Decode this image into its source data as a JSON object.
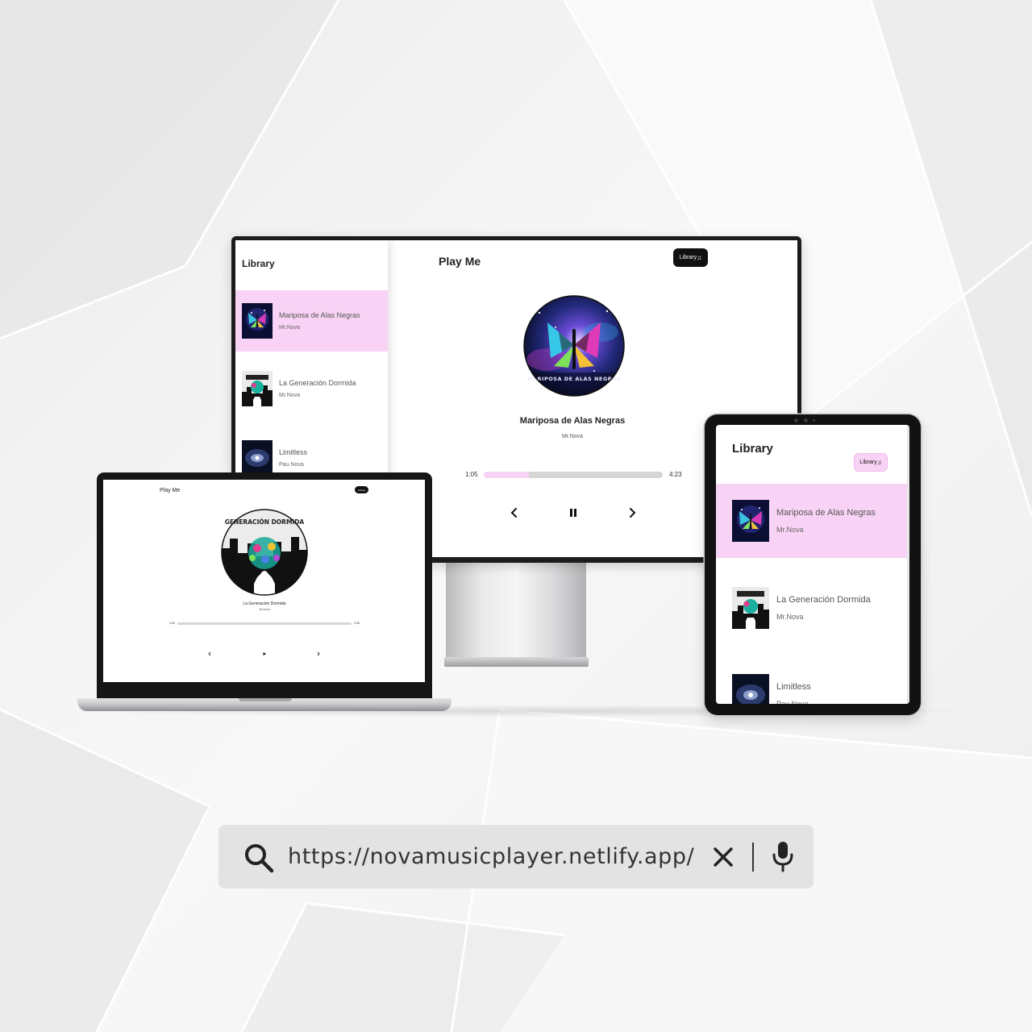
{
  "colors": {
    "accent_pink": "#f9d3f5",
    "screen_bezel": "#1c1c1c",
    "search_bg": "#e3e3e3",
    "text_dark": "#222222"
  },
  "library": {
    "title": "Library",
    "button_label": "Library"
  },
  "app": {
    "title": "Play Me"
  },
  "songs": [
    {
      "name": "Mariposa de Alas Negras",
      "artist": "Mr.Nova",
      "cover": "butterfly-cover"
    },
    {
      "name": "La Generación Dormida",
      "artist": "Mr.Nova",
      "cover": "city-silhouette-cover"
    },
    {
      "name": "Limitless",
      "artist": "Pau.Nova",
      "cover": "galaxy-cover"
    }
  ],
  "desktop_player": {
    "song_index": 0,
    "song_title": "Mariposa de Alas Negras",
    "artist": "Mr.Nova",
    "current_time": "1:05",
    "total_time": "4:23",
    "progress": 0.25,
    "cover_caption": "MARIPOSA DE ALAS NEGRAS",
    "state": "playing",
    "play_icon": "pause-icon"
  },
  "laptop_player": {
    "song_index": 1,
    "song_title": "La Generación Dormida",
    "artist": "Mr.Nova",
    "current_time": "0:00",
    "total_time": "3:28",
    "progress": 0.0,
    "cover_caption": "GENERACIÓN DORMIDA",
    "state": "paused",
    "play_icon": "play-icon"
  },
  "search": {
    "url": "https://novamusicplayer.netlify.app/",
    "search_icon": "search-icon",
    "clear_icon": "close-icon",
    "voice_icon": "microphone-icon"
  }
}
